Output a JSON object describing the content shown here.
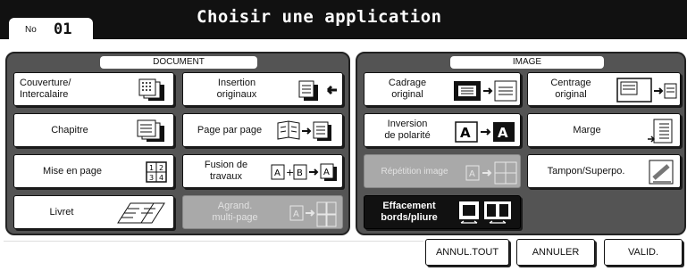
{
  "header": {
    "job_label": "No",
    "job_number": "01",
    "title": "Choisir une application"
  },
  "document_panel": {
    "label": "DOCUMENT",
    "buttons": [
      {
        "label": "Couverture/\nIntercalaire",
        "icon": "cover-sheets-icon",
        "state": "normal"
      },
      {
        "label": "Insertion\noriginaux",
        "icon": "insert-originals-icon",
        "state": "normal"
      },
      {
        "label": "Chapitre",
        "icon": "chapter-icon",
        "state": "normal"
      },
      {
        "label": "Page par page",
        "icon": "book-page-icon",
        "state": "normal"
      },
      {
        "label": "Mise en page",
        "icon": "layout-grid-icon",
        "state": "normal"
      },
      {
        "label": "Fusion de\ntravaux",
        "icon": "job-merge-icon",
        "state": "normal"
      },
      {
        "label": "Livret",
        "icon": "booklet-icon",
        "state": "normal"
      },
      {
        "label": "Agrand.\nmulti-page",
        "icon": "multi-page-enlarge-icon",
        "state": "disabled"
      }
    ]
  },
  "image_panel": {
    "label": "IMAGE",
    "buttons": [
      {
        "label": "Cadrage\noriginal",
        "icon": "original-framing-icon",
        "state": "normal"
      },
      {
        "label": "Centrage\noriginal",
        "icon": "original-centering-icon",
        "state": "normal"
      },
      {
        "label": "Inversion\nde polarité",
        "icon": "polarity-inversion-icon",
        "state": "normal"
      },
      {
        "label": "Marge",
        "icon": "margin-icon",
        "state": "normal"
      },
      {
        "label": "Répétition image",
        "icon": "image-repeat-icon",
        "state": "disabled"
      },
      {
        "label": "Tampon/Superpo.",
        "icon": "stamp-icon",
        "state": "normal"
      },
      {
        "label": "Effacement\nbords/pliure",
        "icon": "edge-fold-erase-icon",
        "state": "active"
      }
    ]
  },
  "footer": {
    "annul_tout": "ANNUL.TOUT",
    "annuler": "ANNULER",
    "valid": "VALID."
  },
  "colors": {
    "panel_bg": "#545454",
    "header_bg": "#111111",
    "active_btn": "#111111",
    "disabled_btn": "#a9a9a9"
  }
}
